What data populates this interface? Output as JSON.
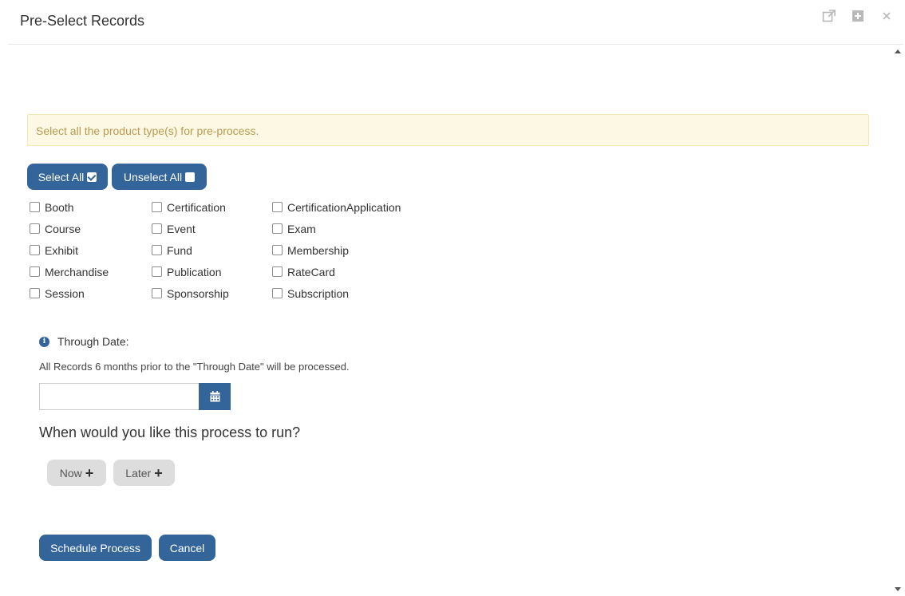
{
  "dialog": {
    "title": "Pre-Select Records",
    "header_icons": [
      "external-link-icon",
      "maximize-icon",
      "close-icon"
    ]
  },
  "alert": {
    "text": "Select all the product type(s) for pre-process."
  },
  "selection_buttons": {
    "select_all": "Select All",
    "unselect_all": "Unselect All"
  },
  "product_types": [
    {
      "label": "Booth",
      "checked": false
    },
    {
      "label": "Certification",
      "checked": false
    },
    {
      "label": "CertificationApplication",
      "checked": false
    },
    {
      "label": "Course",
      "checked": false
    },
    {
      "label": "Event",
      "checked": false
    },
    {
      "label": "Exam",
      "checked": false
    },
    {
      "label": "Exhibit",
      "checked": false
    },
    {
      "label": "Fund",
      "checked": false
    },
    {
      "label": "Membership",
      "checked": false
    },
    {
      "label": "Merchandise",
      "checked": false
    },
    {
      "label": "Publication",
      "checked": false
    },
    {
      "label": "RateCard",
      "checked": false
    },
    {
      "label": "Session",
      "checked": false
    },
    {
      "label": "Sponsorship",
      "checked": false
    },
    {
      "label": "Subscription",
      "checked": false
    }
  ],
  "through_date": {
    "label": "Through Date:",
    "note": "All Records 6 months prior to the \"Through Date\" will be processed.",
    "value": ""
  },
  "run": {
    "question": "When would you like this process to run?",
    "now_label": "Now",
    "later_label": "Later"
  },
  "footer": {
    "schedule_label": "Schedule Process",
    "cancel_label": "Cancel"
  },
  "colors": {
    "primary": "#34659a",
    "alert_bg": "#fcf8e3",
    "alert_text": "#b89b52",
    "gray_button": "#dddddd"
  }
}
